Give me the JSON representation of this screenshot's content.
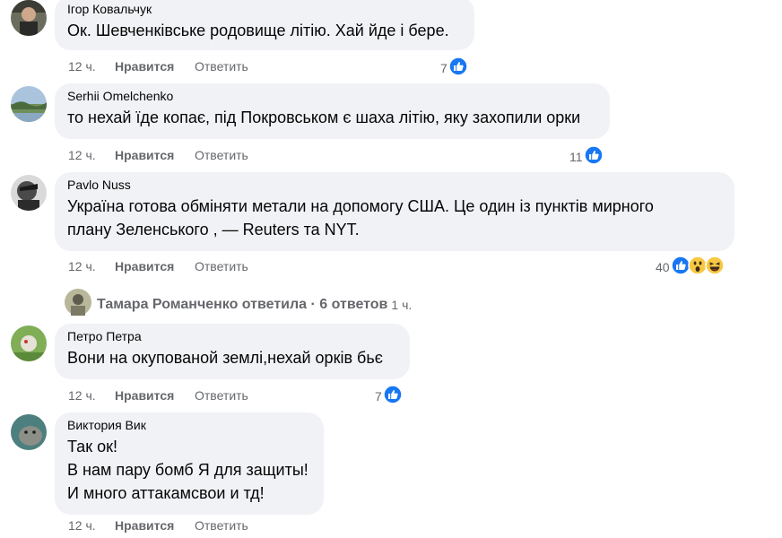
{
  "comments": [
    {
      "author": "Ігор Ковальчук",
      "lines": [
        "Ок. Шевченківське родовище літію. Хай йде і бере."
      ],
      "time": "12 ч.",
      "like": "Нравится",
      "reply": "Ответить",
      "count": "7"
    },
    {
      "author": "Serhii Omelchenko",
      "lines": [
        "то нехай їде копає, під Покровськом є шаха літію, яку захопили орки"
      ],
      "time": "12 ч.",
      "like": "Нравится",
      "reply": "Ответить",
      "count": "11"
    },
    {
      "author": "Pavlo Nuss",
      "lines": [
        "Україна готова обміняти метали на допомогу США. Це один із пунктів мирного",
        "плану Зеленського , — Reuters та NYT."
      ],
      "time": "12 ч.",
      "like": "Нравится",
      "reply": "Ответить",
      "count": "40"
    },
    {
      "author": "Петро Петра",
      "lines": [
        "Вони на окупованой землі,нехай орків бьє"
      ],
      "time": "12 ч.",
      "like": "Нравится",
      "reply": "Ответить",
      "count": "7"
    },
    {
      "author": "Виктория Вик",
      "lines": [
        "Так ок!",
        "В нам пару бомб Я для защиты!",
        "И много аттакамсвои и тд!"
      ],
      "time": "12 ч.",
      "like": "Нравится",
      "reply": "Ответить"
    }
  ],
  "reply_thread": {
    "text": "Тамара Романченко ответила · 6 ответов",
    "time": "1 ч."
  },
  "icons": {
    "like": "like-icon",
    "wow": "wow-emoji-icon",
    "haha": "haha-emoji-icon"
  },
  "colors": {
    "like_blue": "#1877f2",
    "bubble_bg": "#f0f2f5",
    "meta_gray": "#65676b"
  }
}
